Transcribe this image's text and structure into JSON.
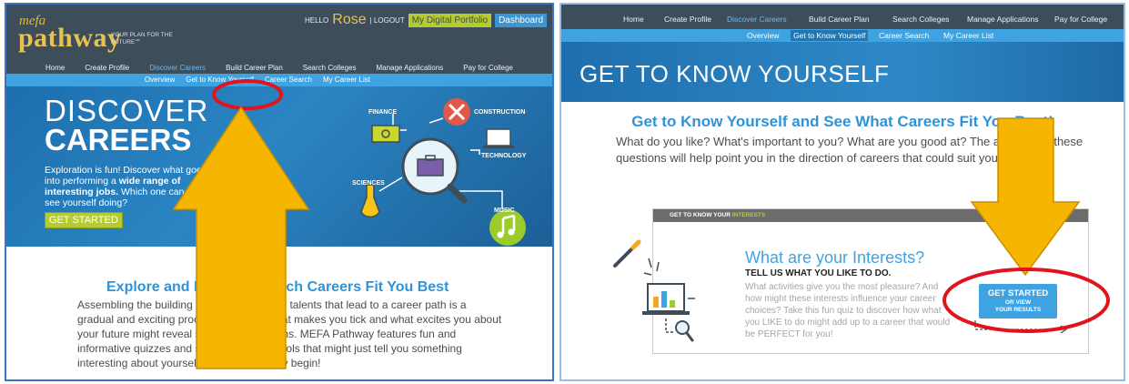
{
  "left": {
    "logo": {
      "mefa": "mefa",
      "pathway": "pathway",
      "tagline": "YOUR PLAN FOR THE FUTURE℠"
    },
    "user": {
      "hello": "HELLO",
      "name": "Rose",
      "logout": "| LOGOUT",
      "portfolio": "My Digital Portfolio",
      "dashboard": "Dashboard"
    },
    "nav": [
      "Home",
      "Create Profile",
      "Discover Careers",
      "Build Career Plan",
      "Search Colleges",
      "Manage Applications",
      "Pay for College"
    ],
    "subnav": [
      "Overview",
      "Get to Know Yourself",
      "Career Search",
      "My Career List"
    ],
    "hero": {
      "title1": "DISCOVER",
      "title2": "CAREERS",
      "text_a": "Exploration is fun! Discover what goes into performing a ",
      "text_b": "wide range of interesting jobs.",
      "text_c": " Which one can you see yourself doing?",
      "button": "GET STARTED",
      "labels": {
        "finance": "FINANCE",
        "construction": "CONSTRUCTION",
        "technology": "TECHNOLOGY",
        "sciences": "SCIENCES",
        "music": "MUSIC"
      }
    },
    "explore": {
      "title": "Explore and Discover Which Careers Fit You Best",
      "text": "Assembling the building blocks of skills and talents that lead to a career path is a gradual and exciting process. Discover what makes you tick and what excites you about your future might reveal some career options. MEFA Pathway features fun and informative quizzes and self-assessment tools that might just tell you something interesting about yourself. Let the discovery begin!"
    }
  },
  "right": {
    "nav": [
      "Home",
      "Create Profile",
      "Discover Careers",
      "Build Career Plan",
      "Search Colleges",
      "Manage Applications",
      "Pay for College"
    ],
    "subnav": [
      "Overview",
      "Get to Know Yourself",
      "Career Search",
      "My Career List"
    ],
    "banner": "GET TO KNOW YOURSELF",
    "heading": "Get to Know Yourself and See What Careers Fit You Best!",
    "intro": "What do you like? What's important to you? What are you good at? The answers to these questions will help point you in the direction of careers that could suit you best.",
    "card": {
      "header_a": "GET TO KNOW YOUR ",
      "header_b": "INTERESTS",
      "title": "What are your Interests?",
      "subtitle": "TELL US WHAT YOU LIKE TO DO.",
      "text": "What activities give you the most pleasure? And how might these interests influence your career choices? Take this fun quiz to discover how what you LIKE to do might add up to a career that would be PERFECT for you!",
      "button_line1": "GET STARTED",
      "button_line2": "OR VIEW",
      "button_line3": "YOUR RESULTS"
    }
  },
  "colors": {
    "accent_blue": "#3fa3e1",
    "nav_dark": "#3e4d5a",
    "lime": "#b6cc2e",
    "arrow": "#f6b500",
    "highlight": "#e1141e"
  }
}
